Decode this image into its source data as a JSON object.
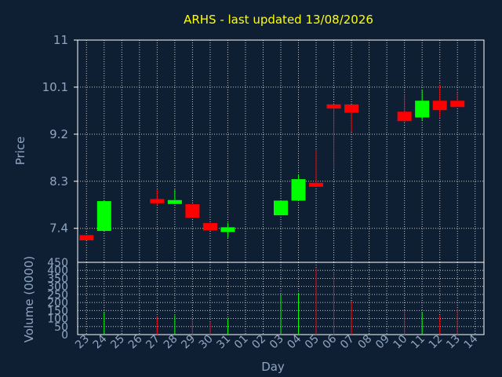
{
  "chart_data": {
    "type": "candlestick",
    "title": "ARHS - last updated 13/08/2026",
    "xlabel": "Day",
    "ylabel": "Price",
    "volume_label": "Volume (0000)",
    "price_ticks": [
      "11",
      "10.1",
      "9.2",
      "8.3",
      "7.4"
    ],
    "price_range": [
      6.75,
      11.0
    ],
    "volume_ticks": [
      "450",
      "400",
      "350",
      "300",
      "250",
      "200",
      "150",
      "100",
      "50",
      "0"
    ],
    "volume_range": [
      0,
      450
    ],
    "x_labels": [
      "23",
      "24",
      "25",
      "26",
      "27",
      "28",
      "29",
      "30",
      "31",
      "01",
      "02",
      "03",
      "04",
      "05",
      "06",
      "07",
      "08",
      "09",
      "10",
      "11",
      "12",
      "13",
      "14"
    ],
    "colors": {
      "up": "#00ff00",
      "down": "#ff0000",
      "title": "#ffff00",
      "axis": "#8fa6c2",
      "background": "#0f1f33",
      "grid": "#c8c8c8"
    },
    "grid": true,
    "candles": [
      {
        "day": "23",
        "open": 7.27,
        "close": 7.17,
        "high": 7.27,
        "low": 7.17,
        "volume": 0
      },
      {
        "day": "24",
        "open": 7.35,
        "close": 7.92,
        "high": 7.92,
        "low": 7.35,
        "volume": 140
      },
      {
        "day": "27",
        "open": 7.96,
        "close": 7.88,
        "high": 8.14,
        "low": 7.84,
        "volume": 110
      },
      {
        "day": "28",
        "open": 7.88,
        "close": 7.94,
        "high": 8.14,
        "low": 7.86,
        "volume": 120
      },
      {
        "day": "29",
        "open": 7.86,
        "close": 7.6,
        "high": 7.86,
        "low": 7.6,
        "volume": 90
      },
      {
        "day": "30",
        "open": 7.5,
        "close": 7.36,
        "high": 7.5,
        "low": 7.36,
        "volume": 80
      },
      {
        "day": "31",
        "open": 7.33,
        "close": 7.42,
        "high": 7.5,
        "low": 7.22,
        "volume": 100
      },
      {
        "day": "03",
        "open": 7.65,
        "close": 7.93,
        "high": 7.93,
        "low": 7.65,
        "volume": 250
      },
      {
        "day": "04",
        "open": 7.93,
        "close": 8.34,
        "high": 8.43,
        "low": 7.93,
        "volume": 260
      },
      {
        "day": "05",
        "open": 8.27,
        "close": 8.24,
        "high": 8.9,
        "low": 8.24,
        "volume": 410
      },
      {
        "day": "06",
        "open": 9.77,
        "close": 9.69,
        "high": 9.77,
        "low": 8.53,
        "volume": 390
      },
      {
        "day": "07",
        "open": 9.77,
        "close": 9.61,
        "high": 9.77,
        "low": 9.24,
        "volume": 210
      },
      {
        "day": "10",
        "open": 9.63,
        "close": 9.45,
        "high": 9.96,
        "low": 9.42,
        "volume": 150
      },
      {
        "day": "11",
        "open": 9.52,
        "close": 9.84,
        "high": 10.05,
        "low": 9.47,
        "volume": 140
      },
      {
        "day": "12",
        "open": 9.84,
        "close": 9.66,
        "high": 10.14,
        "low": 9.52,
        "volume": 120
      },
      {
        "day": "13",
        "open": 9.84,
        "close": 9.72,
        "high": 10.0,
        "low": 9.72,
        "volume": 160
      }
    ]
  }
}
